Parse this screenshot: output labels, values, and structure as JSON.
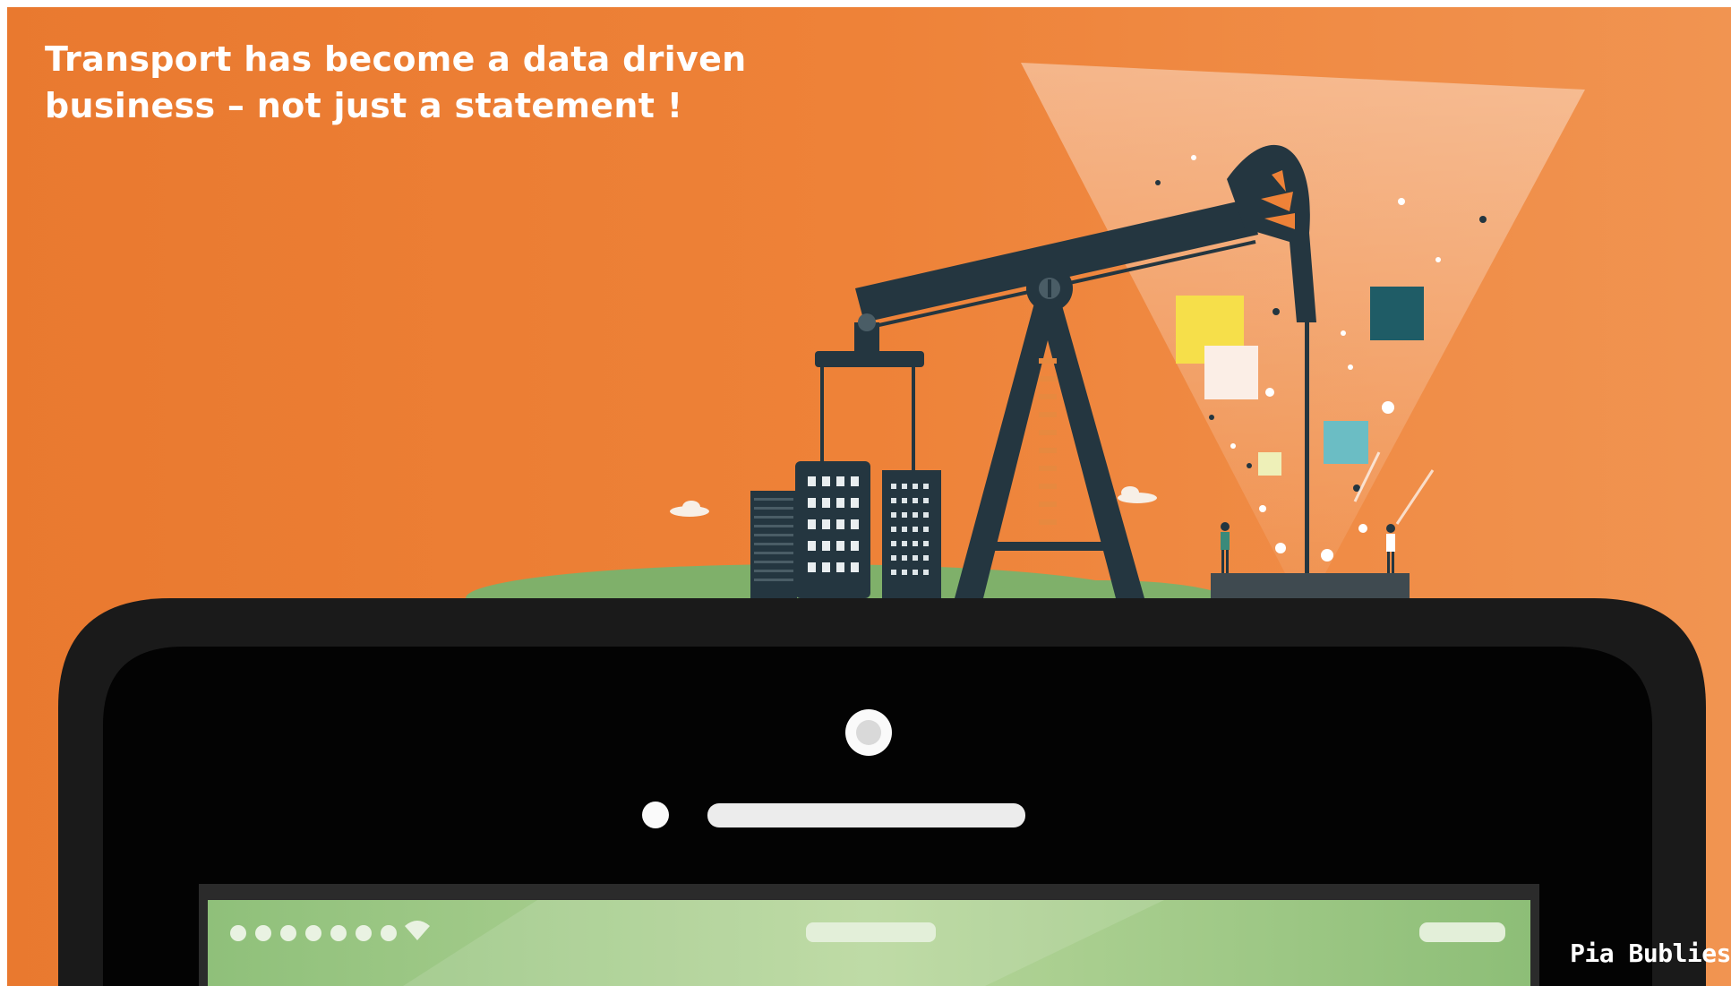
{
  "slide": {
    "headline_lines": [
      "Transport has become a data driven",
      "business – not just a statement !"
    ]
  },
  "illustration": {
    "subject": "oil pumpjack on top of a smartphone",
    "credit": "Pia Bublies",
    "colors": {
      "background": "#EE8238",
      "phone_body": "#1a1a1a",
      "machinery": "#243640",
      "grass": "#7fb06a",
      "screen": "#a9cf8a"
    }
  }
}
